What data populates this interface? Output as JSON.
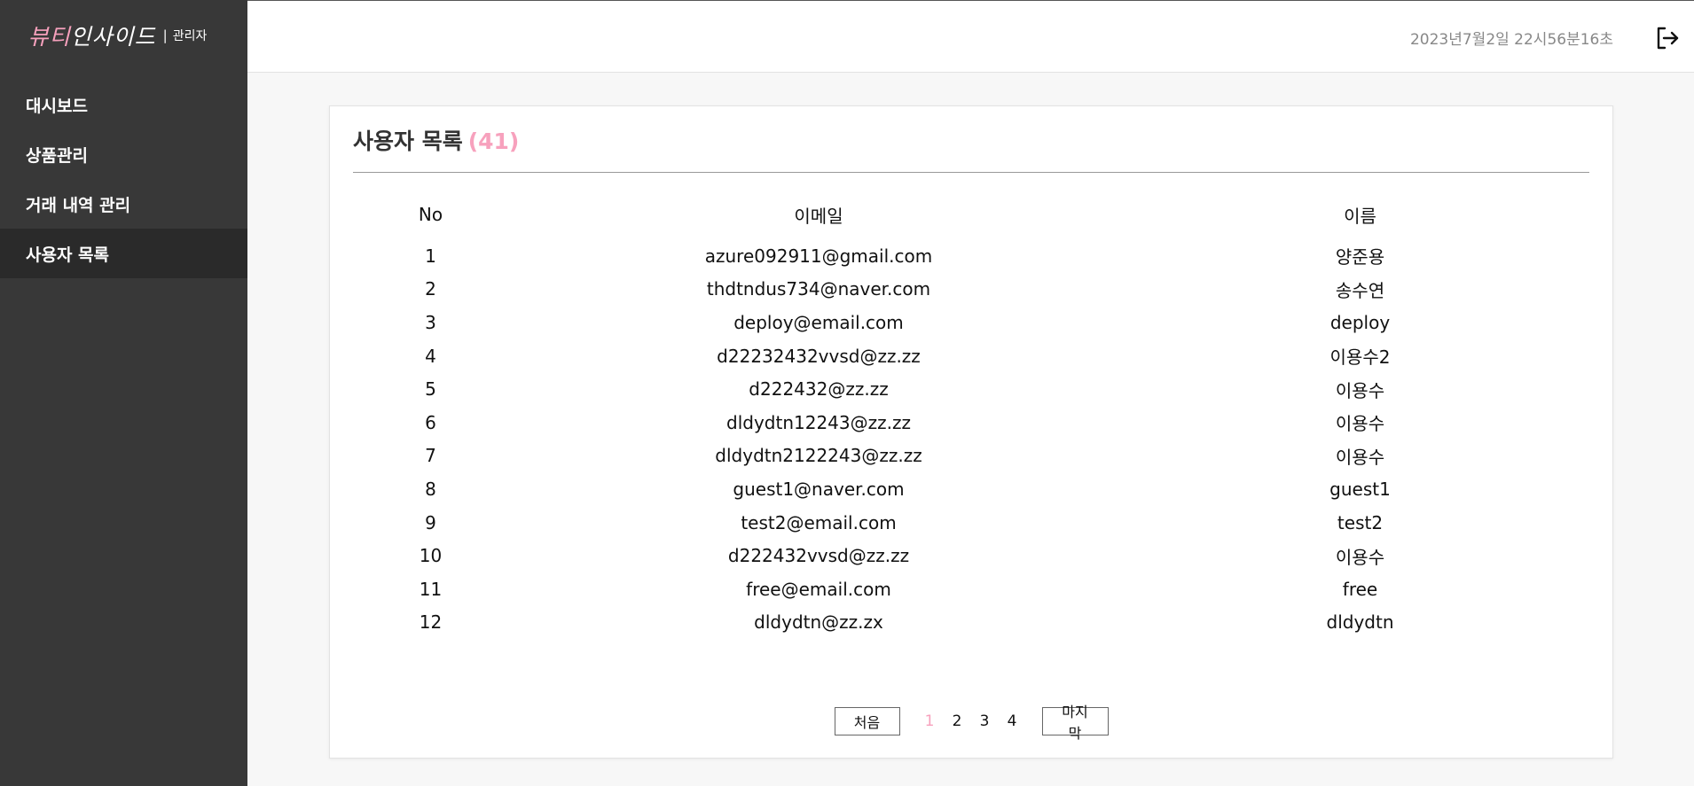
{
  "brand": {
    "logo_pink": "뷰티",
    "logo_white": "인사이드",
    "separator": "|",
    "sub": "관리자"
  },
  "sidebar": {
    "items": [
      {
        "label": "대시보드",
        "active": false
      },
      {
        "label": "상품관리",
        "active": false
      },
      {
        "label": "거래 내역 관리",
        "active": false
      },
      {
        "label": "사용자 목록",
        "active": true
      }
    ]
  },
  "header": {
    "datetime": "2023년7월2일 22시56분16초",
    "logout_icon": "logout-icon"
  },
  "main": {
    "title": "사용자 목록",
    "count": "(41)",
    "columns": [
      "No",
      "이메일",
      "이름"
    ],
    "rows": [
      {
        "no": "1",
        "email": "azure092911@gmail.com",
        "name": "양준용"
      },
      {
        "no": "2",
        "email": "thdtndus734@naver.com",
        "name": "송수연"
      },
      {
        "no": "3",
        "email": "deploy@email.com",
        "name": "deploy"
      },
      {
        "no": "4",
        "email": "d22232432vvsd@zz.zz",
        "name": "이용수2"
      },
      {
        "no": "5",
        "email": "d222432@zz.zz",
        "name": "이용수"
      },
      {
        "no": "6",
        "email": "dldydtn12243@zz.zz",
        "name": "이용수"
      },
      {
        "no": "7",
        "email": "dldydtn2122243@zz.zz",
        "name": "이용수"
      },
      {
        "no": "8",
        "email": "guest1@naver.com",
        "name": "guest1"
      },
      {
        "no": "9",
        "email": "test2@email.com",
        "name": "test2"
      },
      {
        "no": "10",
        "email": "d222432vvsd@zz.zz",
        "name": "이용수"
      },
      {
        "no": "11",
        "email": "free@email.com",
        "name": "free"
      },
      {
        "no": "12",
        "email": "dldydtn@zz.zx",
        "name": "dldydtn"
      }
    ],
    "pagination": {
      "first_label": "처음",
      "last_label": "마지막",
      "pages": [
        "1",
        "2",
        "3",
        "4"
      ],
      "current": "1"
    }
  },
  "colors": {
    "sidebar_bg": "#383838",
    "sidebar_active_bg": "#2a2a2a",
    "accent_pink": "#f7a1bd",
    "page_bg": "#f7f7f7"
  }
}
